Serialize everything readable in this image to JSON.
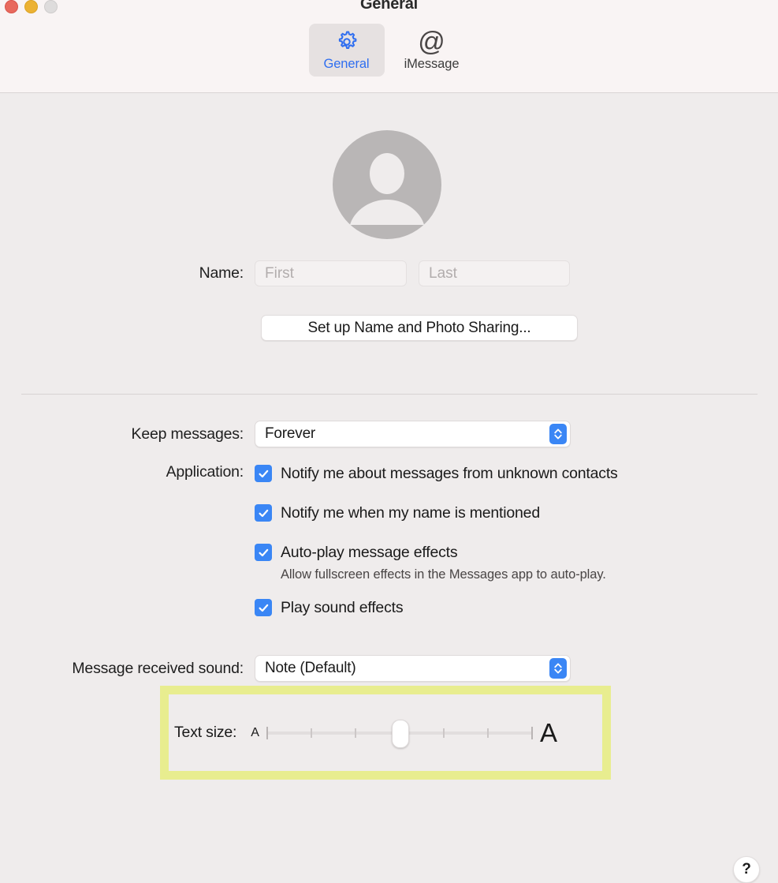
{
  "window": {
    "title": "General",
    "traffic_lights": [
      "close",
      "minimize",
      "zoom"
    ]
  },
  "toolbar": {
    "tabs": [
      {
        "label": "General",
        "icon": "gear-icon",
        "selected": true
      },
      {
        "label": "iMessage",
        "icon": "at-icon",
        "selected": false
      }
    ]
  },
  "profile": {
    "avatar_icon": "person-placeholder-icon",
    "name_label": "Name:",
    "first_placeholder": "First",
    "first_value": "",
    "last_placeholder": "Last",
    "last_value": "",
    "setup_button": "Set up Name and Photo Sharing..."
  },
  "settings": {
    "keep_messages_label": "Keep messages:",
    "keep_messages_value": "Forever",
    "application_label": "Application:",
    "checkboxes": [
      {
        "label": "Notify me about messages from unknown contacts",
        "checked": true
      },
      {
        "label": "Notify me when my name is mentioned",
        "checked": true
      },
      {
        "label": "Auto-play message effects",
        "checked": true
      },
      {
        "label": "Play sound effects",
        "checked": true
      }
    ],
    "autoplay_note": "Allow fullscreen effects in the Messages app to auto-play.",
    "sound_label": "Message received sound:",
    "sound_value": "Note (Default)"
  },
  "text_size": {
    "label": "Text size:",
    "min_glyph": "A",
    "max_glyph": "A",
    "ticks": 7,
    "value": 4,
    "highlight_color": "#e8ed8f"
  },
  "help": {
    "glyph": "?"
  },
  "colors": {
    "accent": "#3a86f5",
    "titlebar_bg": "#f9f4f4",
    "content_bg": "#efecec",
    "tab_selected_bg": "#e6e1e1"
  }
}
